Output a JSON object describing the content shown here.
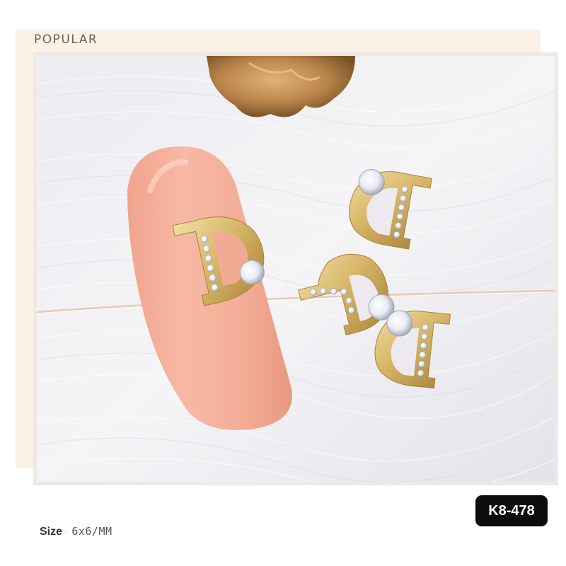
{
  "banner": {
    "label": "POPULAR"
  },
  "product": {
    "code": "K8-478"
  },
  "specs": {
    "size_label": "Size",
    "size_separator": "·",
    "size_value": "6x6/MM"
  },
  "photo": {
    "subject": "gold-letter-d-nail-charms",
    "colors": {
      "feather_background": "#eceaf0",
      "nail": "#f4ad97",
      "gold": "#d9b86a",
      "gold_dark": "#b38f3f",
      "rhinestone": "#f4f5fa",
      "badge": "#0c0c0c"
    }
  }
}
